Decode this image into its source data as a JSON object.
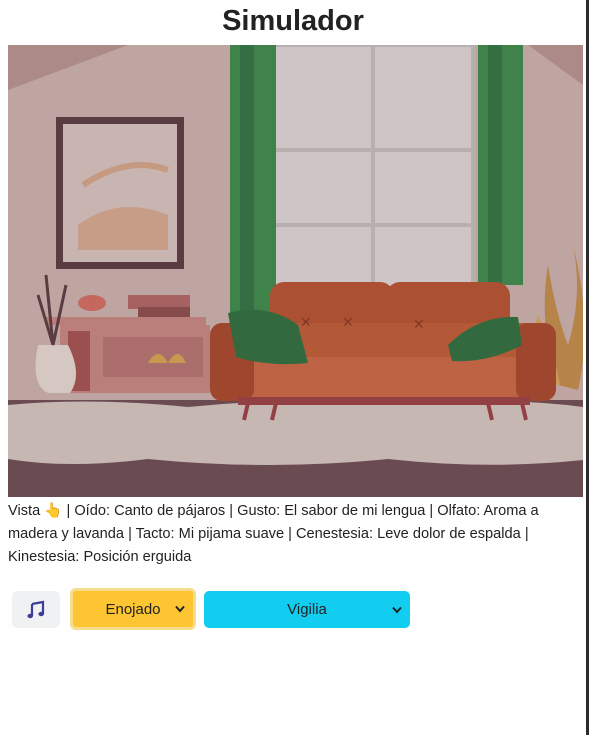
{
  "page": {
    "title": "Simulador"
  },
  "scene": {
    "image_name": "living-room-illustration"
  },
  "senses": [
    {
      "label": "Vista",
      "icon": "pointing-hand-icon",
      "icon_glyph": "👆",
      "value": ""
    },
    {
      "label": "Oído",
      "value": "Canto de pájaros"
    },
    {
      "label": "Gusto",
      "value": "El sabor de mi lengua"
    },
    {
      "label": "Olfato",
      "value": "Aroma a madera y lavanda"
    },
    {
      "label": "Tacto",
      "value": "Mi pijama suave"
    },
    {
      "label": "Cenestesia",
      "value": "Leve dolor de espalda"
    },
    {
      "label": "Kinestesia",
      "value": "Posición erguida"
    }
  ],
  "controls": {
    "music_icon": "music-note-icon",
    "mood": {
      "selected": "Enojado",
      "color": "#fcc531"
    },
    "state": {
      "selected": "Vigilia",
      "color": "#13cdf0"
    }
  },
  "text": {
    "sep": " | ",
    "colon": ": "
  }
}
